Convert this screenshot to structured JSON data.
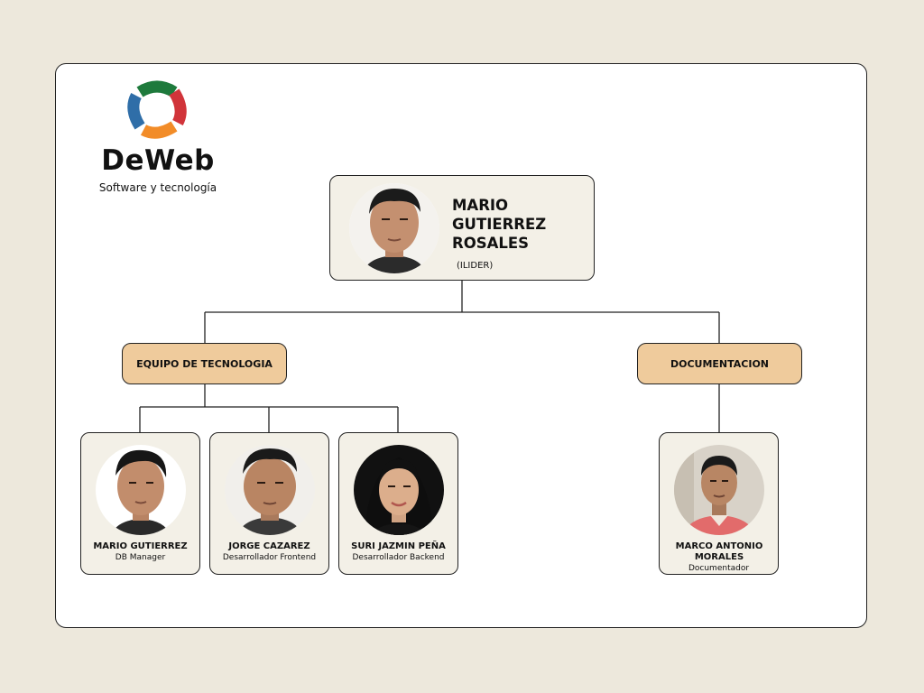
{
  "brand": {
    "name": "DeWeb",
    "tagline": "Software y tecnología",
    "logo_colors": [
      "#1e7a3c",
      "#d1343a",
      "#f28c28",
      "#2f6ea8"
    ]
  },
  "leader": {
    "name": "MARIO GUTIERREZ ROSALES",
    "role": "(ILIDER)"
  },
  "departments": [
    {
      "label": "EQUIPO DE TECNOLOGIA"
    },
    {
      "label": "DOCUMENTACION"
    }
  ],
  "members": [
    {
      "name": "MARIO GUTIERREZ",
      "role": "DB Manager",
      "department": "EQUIPO DE TECNOLOGIA"
    },
    {
      "name": "JORGE CAZAREZ",
      "role": "Desarrollador Frontend",
      "department": "EQUIPO DE TECNOLOGIA"
    },
    {
      "name": "SURI JAZMIN PEÑA",
      "role": "Desarrollador Backend",
      "department": "EQUIPO DE TECNOLOGIA"
    },
    {
      "name": "MARCO ANTONIO MORALES",
      "role": "Documentador",
      "department": "DOCUMENTACION"
    }
  ],
  "colors": {
    "page_background": "#ede8dc",
    "card_background": "#f3f0e7",
    "department_fill": "#efcb9c",
    "connector": "#222222"
  }
}
